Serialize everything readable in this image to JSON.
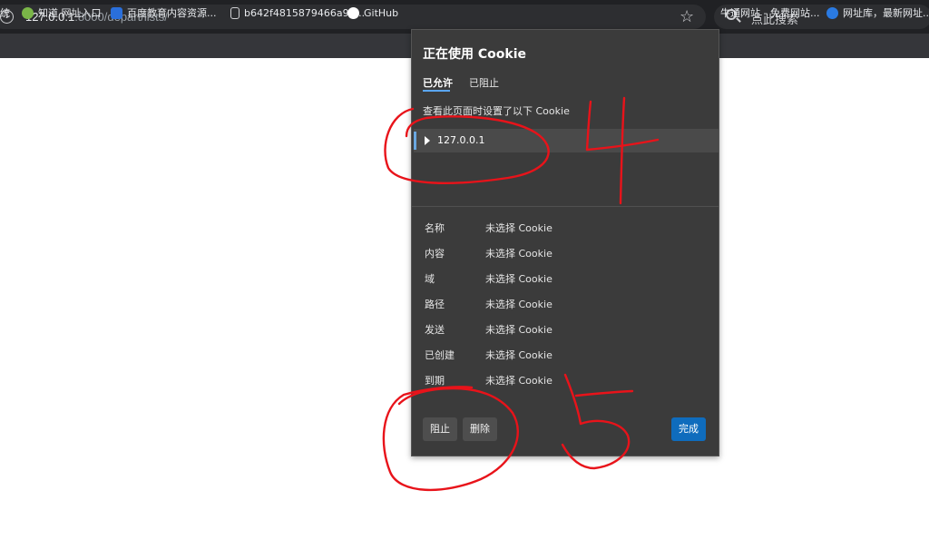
{
  "browser": {
    "url_host": "127.0.0.1",
    "url_rest": ":8000/depart/lists/",
    "search_placeholder": "点此搜索"
  },
  "bookmarks": [
    {
      "label": "统",
      "icon": "bookmark-partial-icon",
      "color": "#4a8bd8"
    },
    {
      "label": "知道  网址入口",
      "icon": "zhidao-icon",
      "color": "#7ab648"
    },
    {
      "label": "百度教育内容资源...",
      "icon": "baidu-icon",
      "color": "#2a6fdb"
    },
    {
      "label": "b642f4815879466a99...",
      "icon": "file-icon",
      "color": "#cfd0d3"
    },
    {
      "label": "GitHub",
      "icon": "github-icon",
      "color": "#ffffff"
    },
    {
      "label": "牛通网站 - 免费网站...",
      "icon": "bookmark-icon",
      "color": "#d44"
    },
    {
      "label": "网址库，最新网址...",
      "icon": "w-icon",
      "color": "#2a7ae2"
    }
  ],
  "cookie_popup": {
    "title": "正在使用 Cookie",
    "tabs": [
      "已允许",
      "已阻止"
    ],
    "description": "查看此页面时设置了以下 Cookie",
    "site": "127.0.0.1",
    "details": [
      {
        "label": "名称",
        "value": "未选择 Cookie"
      },
      {
        "label": "内容",
        "value": "未选择 Cookie"
      },
      {
        "label": "域",
        "value": "未选择 Cookie"
      },
      {
        "label": "路径",
        "value": "未选择 Cookie"
      },
      {
        "label": "发送",
        "value": "未选择 Cookie"
      },
      {
        "label": "已创建",
        "value": "未选择 Cookie"
      },
      {
        "label": "到期",
        "value": "未选择 Cookie"
      }
    ],
    "buttons": {
      "block": "阻止",
      "delete": "删除",
      "done": "完成"
    },
    "accent_color": "#0f6cbd"
  },
  "annotations": {
    "color": "#e8131a",
    "numbers": [
      "4",
      "5"
    ]
  }
}
